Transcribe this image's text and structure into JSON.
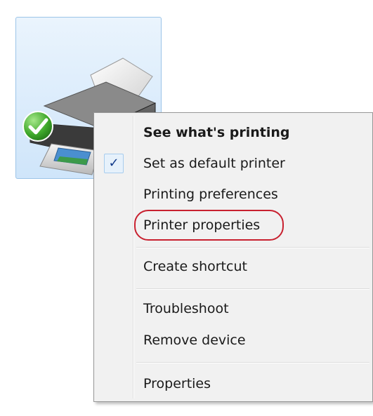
{
  "device": {
    "icon": "printer-icon",
    "status_icon": "check-circle-icon",
    "accent_color": "#cfe5fa"
  },
  "context_menu": {
    "items": [
      {
        "label": "See what's printing",
        "bold": true
      },
      {
        "label": "Set as default printer",
        "checked": true
      },
      {
        "label": "Printing preferences"
      },
      {
        "label": "Printer properties",
        "highlighted": true
      },
      {
        "label": "Create shortcut"
      },
      {
        "label": "Troubleshoot"
      },
      {
        "label": "Remove device"
      },
      {
        "label": "Properties"
      }
    ],
    "check_glyph": "✓",
    "highlight_color": "#c8202f"
  }
}
